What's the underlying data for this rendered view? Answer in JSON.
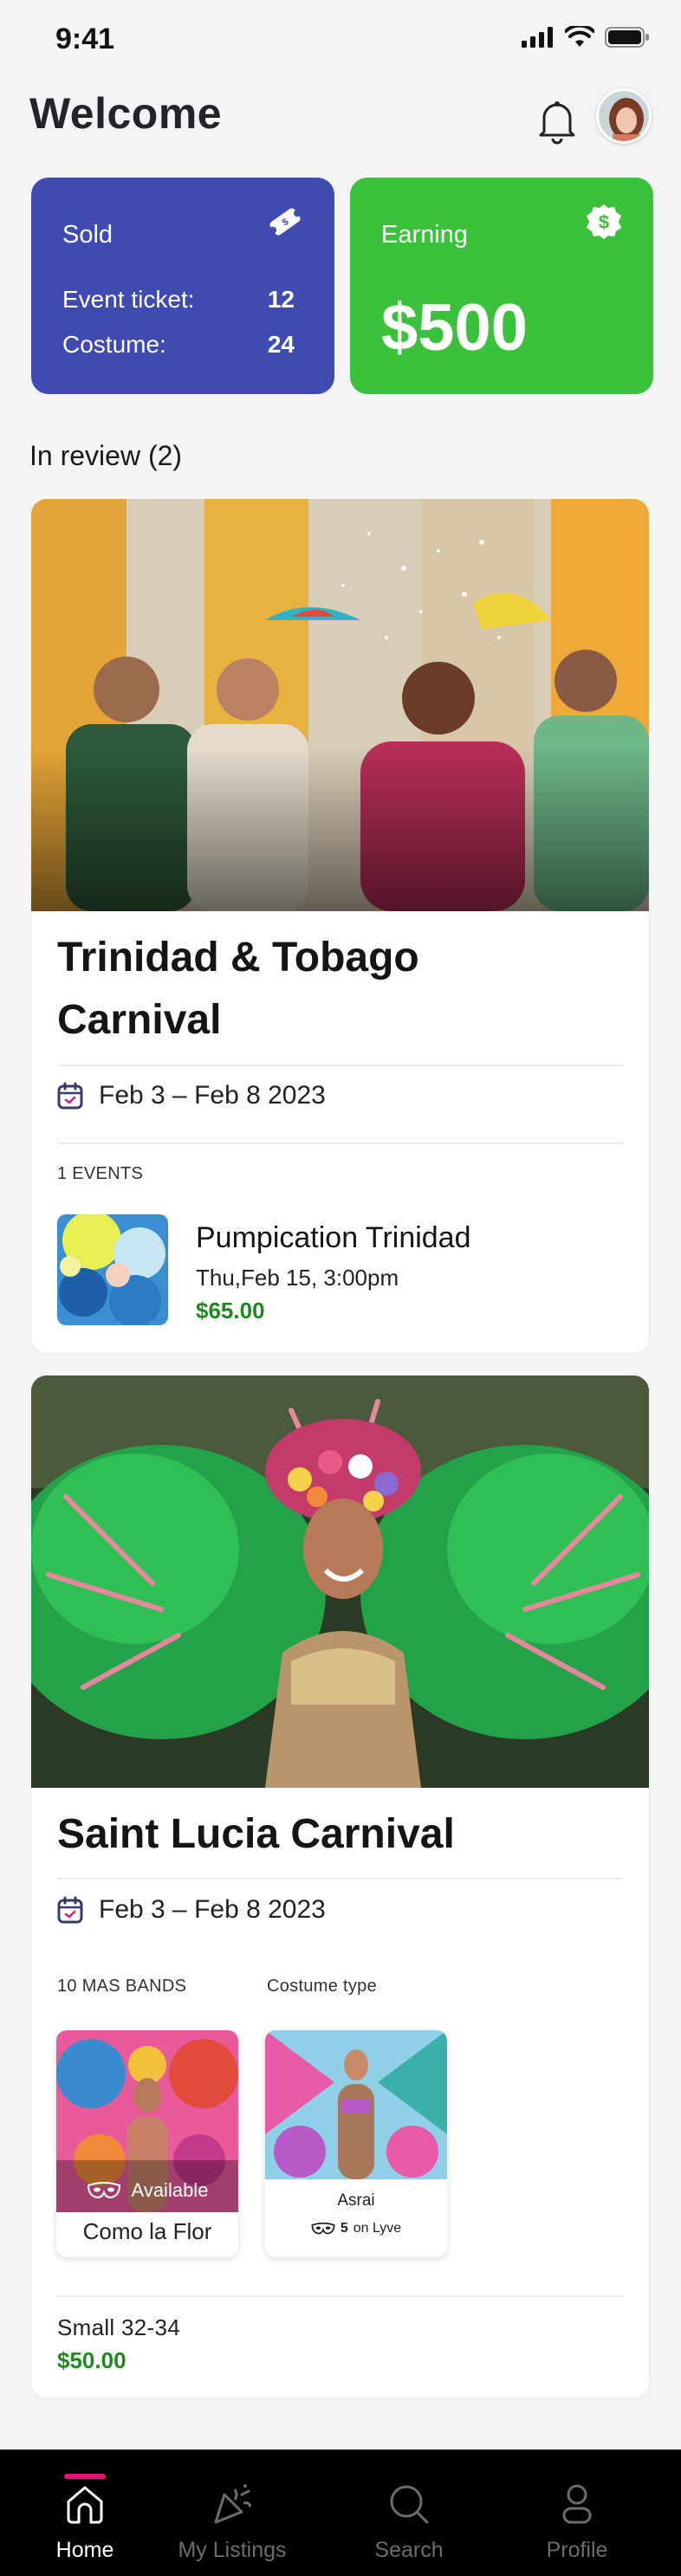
{
  "status_bar": {
    "time": "9:41"
  },
  "header": {
    "title": "Welcome"
  },
  "sold_card": {
    "title": "Sold",
    "rows": [
      {
        "label": "Event ticket:",
        "value": "12"
      },
      {
        "label": "Costume:",
        "value": "24"
      }
    ]
  },
  "earning_card": {
    "title": "Earning",
    "value": "$500"
  },
  "in_review": {
    "title": "In review (2)"
  },
  "carnival1": {
    "name_line1": "Trinidad & Tobago",
    "name_line2": "Carnival",
    "dates": "Feb 3 – Feb 8 2023",
    "events_label": "1 EVENTS",
    "event": {
      "title": "Pumpication Trinidad",
      "date": "Thu,Feb 15, 3:00pm",
      "price": "$65.00"
    }
  },
  "carnival2": {
    "name": "Saint Lucia Carnival",
    "dates": "Feb 3 – Feb 8 2023",
    "bands_label": "10 MAS BANDS",
    "costume_type_label": "Costume type",
    "band1": {
      "status": "Available",
      "name": "Como la Flor"
    },
    "band2": {
      "name": "Asrai",
      "count": "5",
      "count_suffix": "on Lyve"
    },
    "size": "Small 32-34",
    "price": "$50.00"
  },
  "nav": {
    "items": [
      {
        "label": "Home",
        "icon": "home-icon"
      },
      {
        "label": "My Listings",
        "icon": "party-popper-icon"
      },
      {
        "label": "Search",
        "icon": "search-icon"
      },
      {
        "label": "Profile",
        "icon": "profile-icon"
      }
    ]
  },
  "colors": {
    "sold": "#3f4bb1",
    "earning": "#3cc13c",
    "price": "#1e8a1e",
    "nav_active": "#e0157b"
  }
}
